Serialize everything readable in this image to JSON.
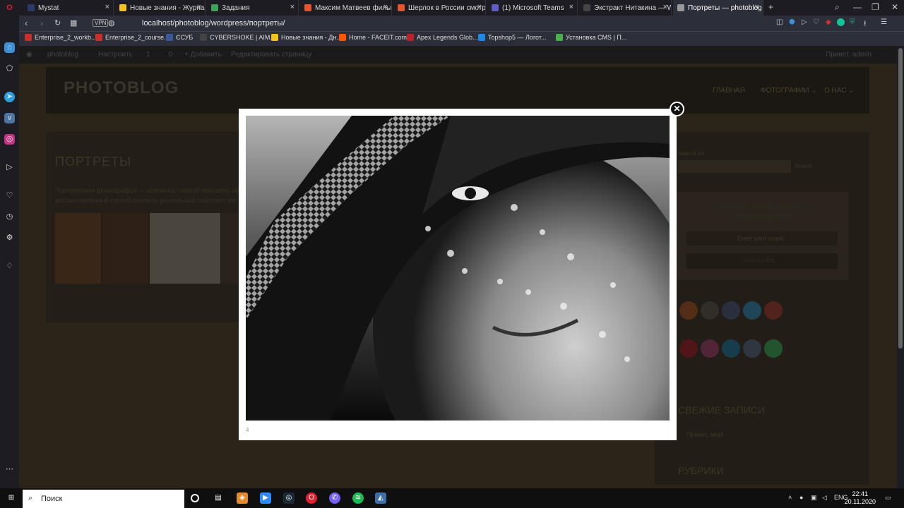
{
  "tabs": [
    {
      "label": "Mystat",
      "color": "#2a3a6a"
    },
    {
      "label": "Новые знания - Журнал с",
      "color": "#f3c21b"
    },
    {
      "label": "Задания",
      "color": "#3aa35a"
    },
    {
      "label": "Максим Матвеев фильм",
      "color": "#e5542b"
    },
    {
      "label": "Шерлок в России смотре",
      "color": "#e5542b"
    },
    {
      "label": "(1) Microsoft Teams",
      "color": "#5b5fc7"
    },
    {
      "label": "Экстракт Нитакина — Warf",
      "color": "#444"
    },
    {
      "label": "Портреты — photoblog",
      "color": "#999"
    }
  ],
  "new_tab": "+",
  "tab_close": "×",
  "window_controls": {
    "minimize": "—",
    "restore": "❐",
    "close": "✕"
  },
  "address": {
    "vpn": "VPN",
    "url": "localhost/photoblog/wordpress/портреты/"
  },
  "bookmarks": [
    {
      "label": "Enterprise_2_workb...",
      "color": "#c9302c"
    },
    {
      "label": "Enterprise_2_course...",
      "color": "#c9302c"
    },
    {
      "label": "ЄСУБ",
      "color": "#3b5998"
    },
    {
      "label": "CYBERSHOKE | AIM...",
      "color": "#444"
    },
    {
      "label": "Новые знания - Дн...",
      "color": "#f3c21b"
    },
    {
      "label": "Home - FACEIT.com",
      "color": "#ff5500"
    },
    {
      "label": "Apex Legends Glob...",
      "color": "#b8232a"
    },
    {
      "label": "Topshop5 — Логот...",
      "color": "#1e88e5"
    },
    {
      "label": "Установка CMS | П...",
      "color": "#4caf50"
    }
  ],
  "wp_admin_bar": {
    "site": "photoblog",
    "customize": "Настроить",
    "updates": "1",
    "comments": "0",
    "add": "+ Добавить",
    "edit": "Редактировать страницу",
    "greeting": "Привет, admin"
  },
  "site": {
    "logo": "PHOTOBLOG",
    "nav": [
      "ГЛАВНАЯ",
      "ФОТОГРАФИИ ⌄",
      "О НАС ⌄"
    ],
    "page_title": "ПОРТРЕТЫ",
    "desc_line1": "Портретная фотография — истинный способ показать запе",
    "desc_line2": "воспроизводимый способ сделать уникальный портрет зак"
  },
  "widgets": {
    "search_label": "Search for:",
    "search_button": "Search",
    "subscribe_title": "Получать новые записи по электронной почте:",
    "email_placeholder": "Enter your email",
    "subscribe_button": "Subscribe",
    "recent_title": "СВЕЖИЕ ЗАПИСИ",
    "recent_item": "Привет, мир!",
    "categories_title": "РУБРИКИ",
    "social_row1": [
      "#c8521a",
      "#555",
      "#3b5998",
      "#1da1f2",
      "#c4302b"
    ],
    "social_row2": [
      "#bd081c",
      "#c13584",
      "#0088cc",
      "#4c75a3",
      "#25d366"
    ]
  },
  "lightbox": {
    "counter": "4",
    "close_symbol": "✕"
  },
  "taskbar": {
    "search_placeholder": "Поиск",
    "lang": "ENG",
    "time": "22:41",
    "date": "20.11.2020"
  }
}
